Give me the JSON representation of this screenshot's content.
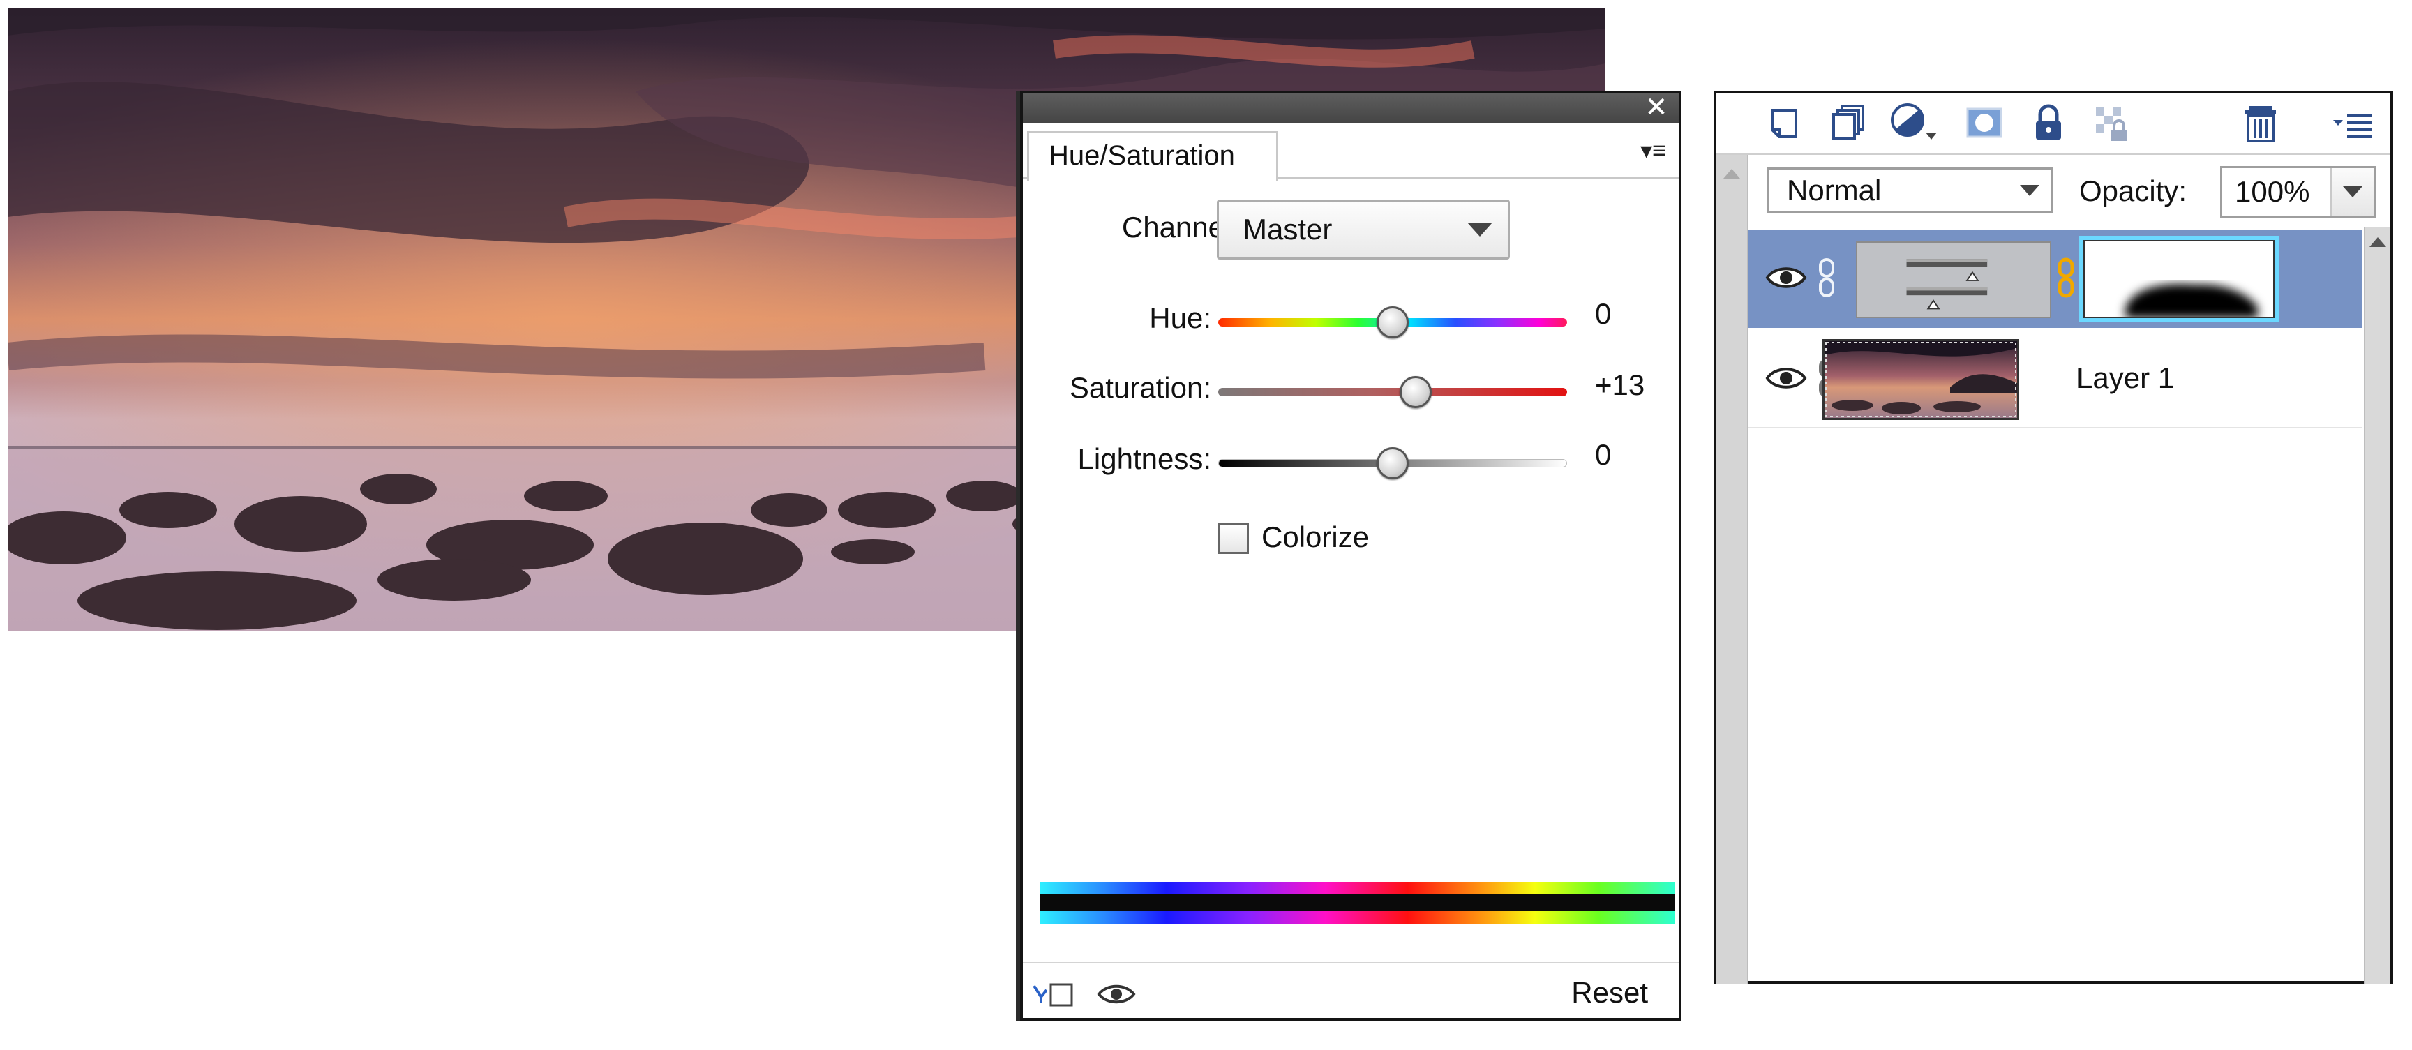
{
  "hue_saturation": {
    "tab_label": "Hue/Saturation",
    "channel_label": "Channel:",
    "channel_value": "Master",
    "sliders": [
      {
        "label": "Hue:",
        "value": "0",
        "fraction": 0.5
      },
      {
        "label": "Saturation:",
        "value": "+13",
        "fraction": 0.565
      },
      {
        "label": "Lightness:",
        "value": "0",
        "fraction": 0.5
      }
    ],
    "colorize_label": "Colorize",
    "colorize_checked": false,
    "reset_label": "Reset",
    "close_glyph": "✕",
    "menu_glyph": "▾≡"
  },
  "layers": {
    "blend_mode": "Normal",
    "opacity_label": "Opacity:",
    "opacity_value": "100%",
    "toolbar_icons": [
      "new-layer-icon",
      "new-group-icon",
      "adjustment-layer-icon",
      "layer-mask-icon",
      "lock-all-icon",
      "lock-transparency-icon",
      "delete-layer-icon",
      "panel-menu-icon"
    ],
    "items": [
      {
        "name": "",
        "type": "adjustment",
        "selected": true,
        "visible": true
      },
      {
        "name": "Layer 1",
        "type": "pixel",
        "selected": false,
        "visible": true
      }
    ]
  },
  "colors": {
    "selection": "#7792c4",
    "mask_highlight": "#6bd8ff",
    "title_bar": "#4f4f4f"
  }
}
